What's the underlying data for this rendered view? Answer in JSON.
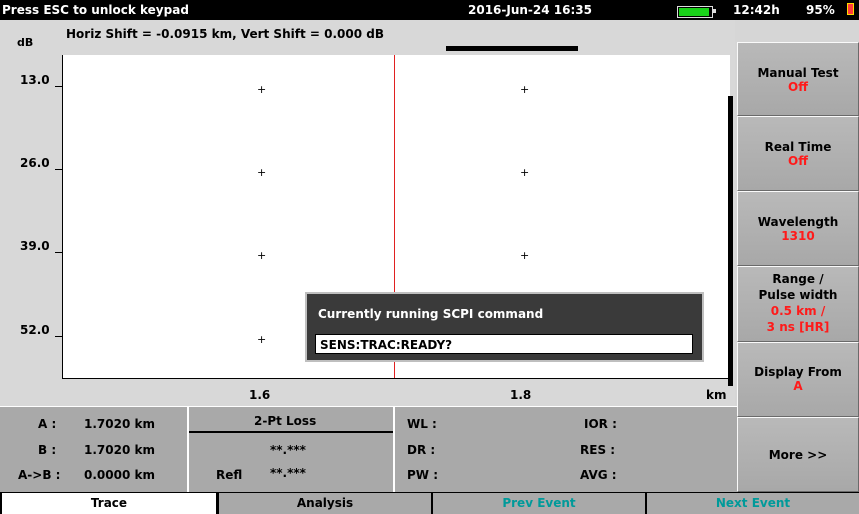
{
  "status_bar": {
    "message": "Press ESC to unlock keypad",
    "datetime": "2016-Jun-24 16:35",
    "battery_level": 0.95,
    "battery_color": "#19d219",
    "time_remaining": "12:42h",
    "battery_percent": "95%",
    "battery_alert_icon": "battery-warning-icon"
  },
  "chart": {
    "shift_info": "Horiz Shift = -0.0915 km, Vert Shift = 0.000 dB",
    "y_unit": "dB",
    "x_unit": "km",
    "y_ticks": [
      "13.0",
      "26.0",
      "39.0",
      "52.0"
    ],
    "x_ticks": [
      "1.6",
      "1.8"
    ],
    "marker_color": "#e02020"
  },
  "dialog": {
    "title": "Currently running SCPI command",
    "command": "SENS:TRAC:READY?"
  },
  "softkeys": [
    {
      "label": "Manual Test",
      "value": "Off"
    },
    {
      "label": "Real Time",
      "value": "Off"
    },
    {
      "label": "Wavelength",
      "value": "1310"
    },
    {
      "label": "Range /",
      "label2": "Pulse width",
      "value": "0.5 km /",
      "value2": "3 ns [HR]"
    },
    {
      "label": "Display From",
      "value": "A"
    },
    {
      "label": "More >>"
    }
  ],
  "info": {
    "a_label": "A :",
    "a_value": "1.7020 km",
    "b_label": "B :",
    "b_value": "1.7020 km",
    "ab_label": "A->B :",
    "ab_value": "0.0000 km",
    "loss_title": "2-Pt Loss",
    "loss_value": "**.***",
    "refl_label": "Refl",
    "refl_value": "**.***",
    "wl_label": "WL :",
    "dr_label": "DR :",
    "pw_label": "PW :",
    "ior_label": "IOR :",
    "res_label": "RES :",
    "avg_label": "AVG :"
  },
  "tabs": [
    {
      "label": "Trace",
      "active": true
    },
    {
      "label": "Analysis",
      "active": false
    },
    {
      "label": "Prev Event",
      "active": false
    },
    {
      "label": "Next Event",
      "active": false
    }
  ],
  "colors": {
    "accent_value": "#ff1a1a",
    "inactive_tab_text": "#009a9a"
  }
}
